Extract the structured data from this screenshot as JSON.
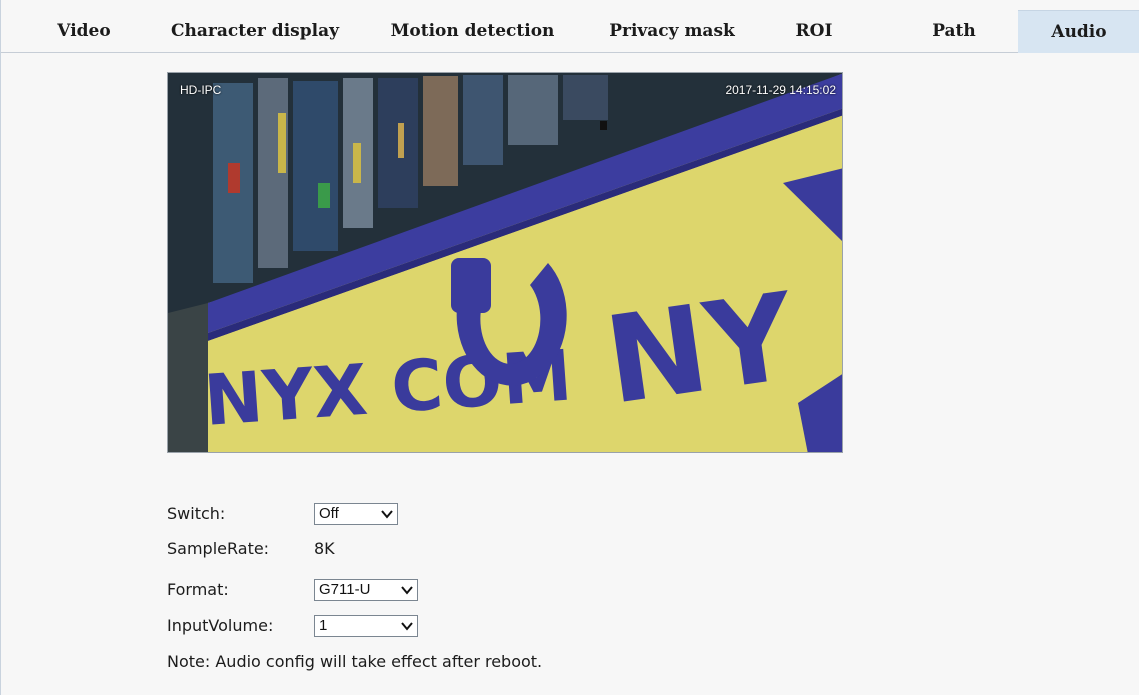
{
  "tabs": [
    {
      "label": "Video"
    },
    {
      "label": "Character display"
    },
    {
      "label": "Motion detection"
    },
    {
      "label": "Privacy mask"
    },
    {
      "label": "ROI"
    },
    {
      "label": "Path"
    },
    {
      "label": "Audio",
      "active": true
    }
  ],
  "preview": {
    "osd_name": "HD-IPC",
    "osd_time": "2017-11-29 14:15:02",
    "sign_text": "NYX COM",
    "sign_text_right": "NY"
  },
  "form": {
    "switch_label": "Switch:",
    "switch_value": "Off",
    "samplerate_label": "SampleRate:",
    "samplerate_value": "8K",
    "format_label": "Format:",
    "format_value": "G711-U",
    "inputvolume_label": "InputVolume:",
    "inputvolume_value": "1",
    "note": "Note: Audio config will take effect after reboot."
  },
  "colors": {
    "active_tab": "#d7e5f2",
    "sign_yellow": "#ddd56a",
    "sign_blue": "#3b3c9e"
  }
}
